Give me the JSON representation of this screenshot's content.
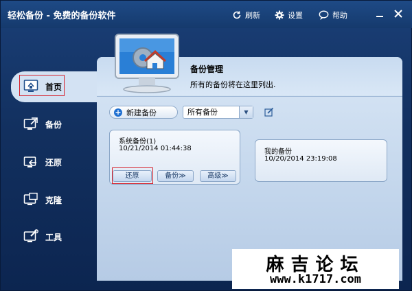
{
  "app": {
    "title": "轻松备份 - 免费的备份软件"
  },
  "toolbar": {
    "refresh_label": "刷新",
    "settings_label": "设置",
    "help_label": "帮助"
  },
  "sidebar": {
    "items": [
      {
        "label": "首页",
        "icon": "home-monitor-icon",
        "active": true
      },
      {
        "label": "备份",
        "icon": "backup-icon"
      },
      {
        "label": "还原",
        "icon": "restore-icon"
      },
      {
        "label": "克隆",
        "icon": "clone-icon"
      },
      {
        "label": "工具",
        "icon": "tools-icon"
      }
    ]
  },
  "header": {
    "title": "备份管理",
    "description": "所有的备份将在这里列出."
  },
  "actions": {
    "new_backup_label": "新建备份",
    "filter_selected": "所有备份"
  },
  "backups": [
    {
      "name": "系统备份(1)",
      "time": "10/21/2014 01:44:38",
      "buttons": {
        "restore": "还原",
        "backup": "备份",
        "advanced": "高级"
      }
    },
    {
      "name": "我的备份",
      "time": "10/20/2014 23:19:08"
    }
  ],
  "watermark": {
    "title": "麻吉论坛",
    "url": "www.k1717.com"
  },
  "colors": {
    "window_bg": "#12305f",
    "highlight": "#d6202a",
    "panel_bg": "#c3d6ec"
  }
}
